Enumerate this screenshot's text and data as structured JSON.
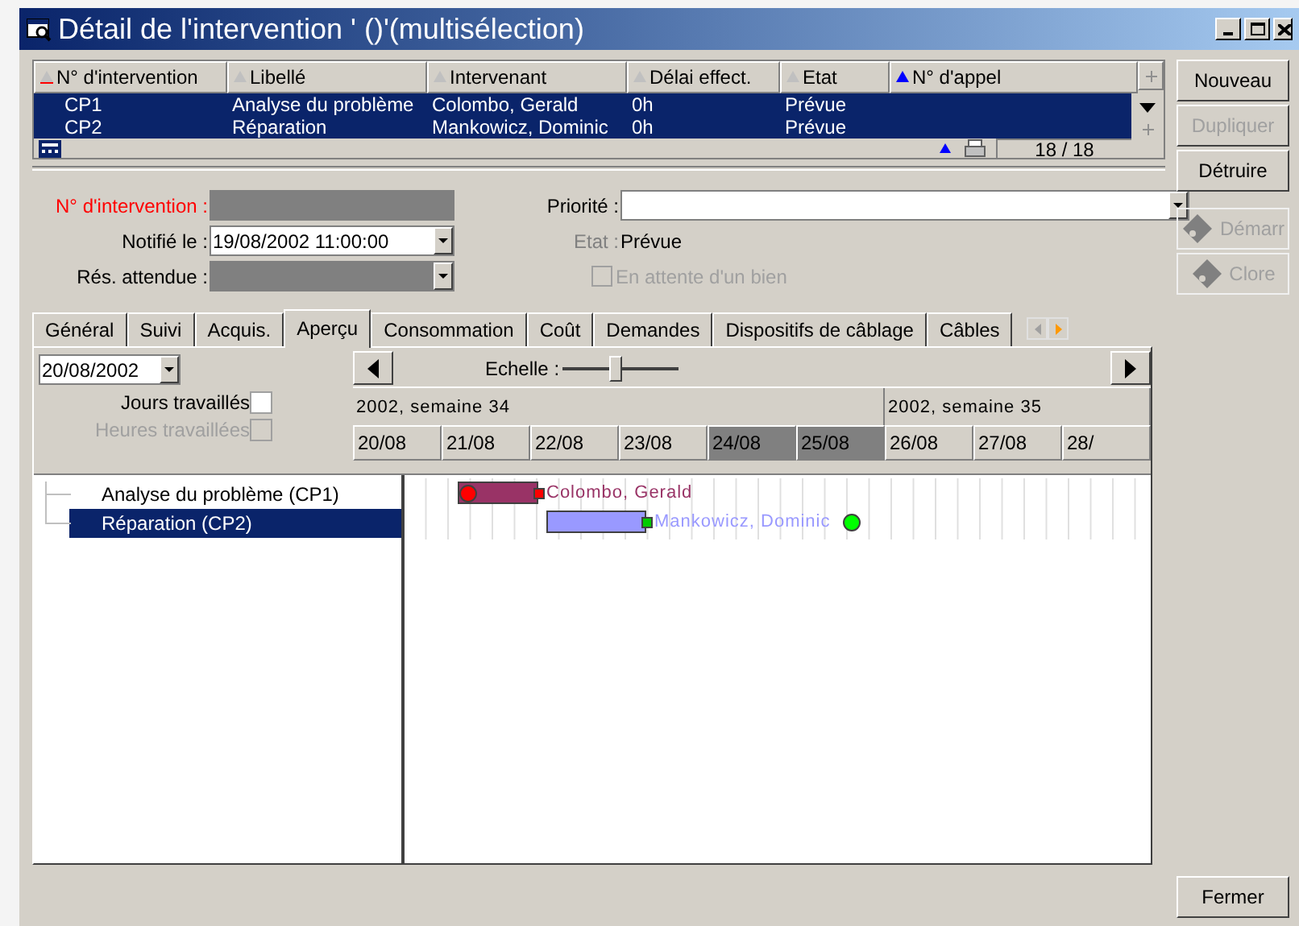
{
  "window": {
    "title": "Détail de l'intervention ' ()'(multisélection)"
  },
  "grid": {
    "columns": [
      {
        "label": "N° d'intervention",
        "sorted": false,
        "primary": true
      },
      {
        "label": "Libellé",
        "sorted": false,
        "primary": false
      },
      {
        "label": "Intervenant",
        "sorted": false,
        "primary": false
      },
      {
        "label": "Délai effect.",
        "sorted": false,
        "primary": false
      },
      {
        "label": "Etat",
        "sorted": false,
        "primary": false
      },
      {
        "label": "N° d'appel",
        "sorted": true,
        "primary": false
      }
    ],
    "rows": [
      {
        "cells": [
          "CP1",
          "Analyse du problème",
          "Colombo, Gerald",
          "0h",
          "Prévue"
        ],
        "selected": true
      },
      {
        "cells": [
          "CP2",
          "Réparation",
          "Mankowicz, Dominic",
          "0h",
          "Prévue"
        ],
        "selected": true
      }
    ],
    "counter": "18 / 18"
  },
  "side_buttons": [
    {
      "label": "Nouveau",
      "disabled": false
    },
    {
      "label": "Dupliquer",
      "disabled": true
    },
    {
      "label": "Détruire",
      "disabled": false
    }
  ],
  "action_buttons": [
    {
      "label": "Démarr",
      "disabled": true
    },
    {
      "label": "Clore",
      "disabled": true
    }
  ],
  "close_button": "Fermer",
  "form": {
    "number_label": "N° d'intervention :",
    "notified_label": "Notifié le :",
    "notified_value": "19/08/2002 11:00:00",
    "expected_label": "Rés. attendue :",
    "priority_label": "Priorité :",
    "state_label": "Etat :",
    "state_value": "Prévue",
    "waiting": {
      "label": "En attente d'un bien",
      "checked": false,
      "disabled": true
    }
  },
  "tabs": [
    {
      "label": "Général",
      "selected": false
    },
    {
      "label": "Suivi",
      "selected": false
    },
    {
      "label": "Acquis.",
      "selected": false
    },
    {
      "label": "Aperçu",
      "selected": true
    },
    {
      "label": "Consommation",
      "selected": false
    },
    {
      "label": "Coût",
      "selected": false
    },
    {
      "label": "Demandes",
      "selected": false
    },
    {
      "label": "Dispositifs de câblage",
      "selected": false
    },
    {
      "label": "Câbles",
      "selected": false
    }
  ],
  "gantt": {
    "date": "20/08/2002",
    "scale_label": "Echelle :",
    "scale": {
      "level": 0.45
    },
    "options": [
      {
        "label": "Jours travaillés",
        "checked": false,
        "disabled": false
      },
      {
        "label": "Heures travaillées",
        "checked": false,
        "disabled": true
      }
    ],
    "weeks": [
      "2002, semaine 34",
      "2002, semaine 35"
    ],
    "days": [
      {
        "label": "20/08",
        "weekend": false
      },
      {
        "label": "21/08",
        "weekend": false
      },
      {
        "label": "22/08",
        "weekend": false
      },
      {
        "label": "23/08",
        "weekend": false
      },
      {
        "label": "24/08",
        "weekend": true
      },
      {
        "label": "25/08",
        "weekend": true
      },
      {
        "label": "26/08",
        "weekend": false
      },
      {
        "label": "27/08",
        "weekend": false
      },
      {
        "label": "28/",
        "weekend": false
      }
    ],
    "tasks": [
      {
        "label": "Analyse du problème (CP1)",
        "selected": false,
        "assignee": "Colombo, Gerald",
        "color": "#993366"
      },
      {
        "label": "Réparation (CP2)",
        "selected": true,
        "assignee": "Mankowicz, Dominic",
        "color": "#9999ff"
      }
    ]
  }
}
